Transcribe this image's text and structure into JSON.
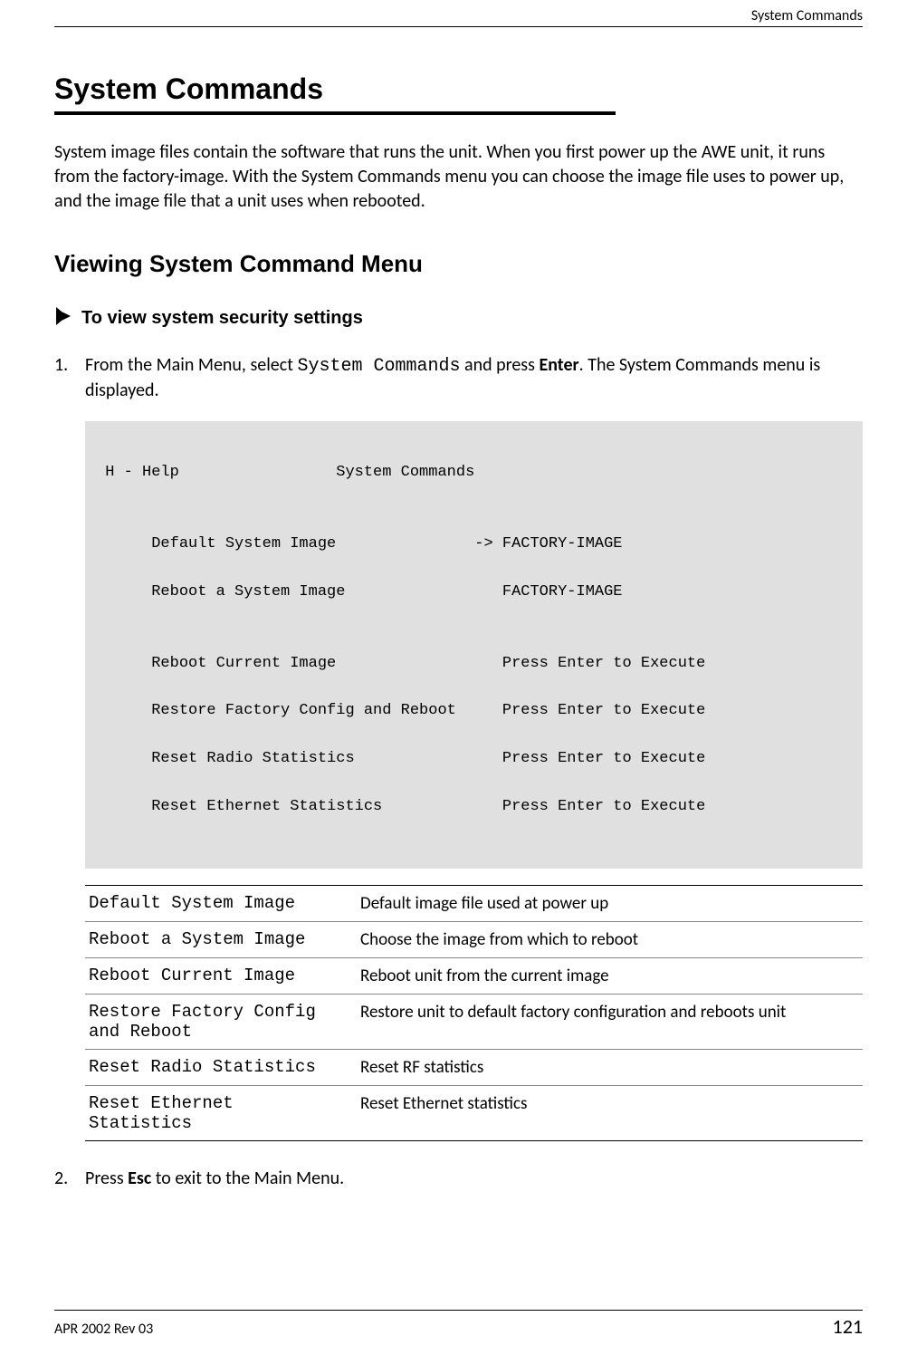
{
  "header": {
    "running_title": "System Commands"
  },
  "h1": "System Commands",
  "intro": "System image files contain the software that runs the unit. When you first power up the AWE unit, it runs from the factory-image. With the System Commands menu you can choose the image file uses to power up, and the image file that a unit uses when rebooted.",
  "h2": "Viewing System Command Menu",
  "task_label": "To view system security settings",
  "step1_a": "From the Main Menu, select ",
  "step1_mono": "System Commands",
  "step1_b": " and press ",
  "step1_bold": "Enter",
  "step1_c": ". The System Commands menu is displayed.",
  "terminal": {
    "header": " H - Help                 System Commands",
    "lines": [
      "      Default System Image               -> FACTORY-IMAGE",
      "      Reboot a System Image                 FACTORY-IMAGE",
      "",
      "      Reboot Current Image                  Press Enter to Execute",
      "      Restore Factory Config and Reboot     Press Enter to Execute",
      "      Reset Radio Statistics                Press Enter to Execute",
      "      Reset Ethernet Statistics             Press Enter to Execute"
    ]
  },
  "defs": [
    {
      "term": "Default System Image",
      "desc": "Default image file used at power up"
    },
    {
      "term": "Reboot a System Image",
      "desc": "Choose the image from which to reboot"
    },
    {
      "term": "Reboot Current Image",
      "desc": "Reboot unit from the current image"
    },
    {
      "term": "Restore Factory Config and Reboot",
      "desc": "Restore unit to default factory configuration and reboots unit"
    },
    {
      "term": "Reset Radio Statistics",
      "desc": "Reset RF statistics"
    },
    {
      "term": "Reset Ethernet Statistics",
      "desc": "Reset Ethernet statistics"
    }
  ],
  "step2_a": "Press ",
  "step2_bold": "Esc",
  "step2_b": " to exit to the Main Menu.",
  "footer": {
    "left": "APR 2002 Rev 03",
    "page": "121"
  }
}
